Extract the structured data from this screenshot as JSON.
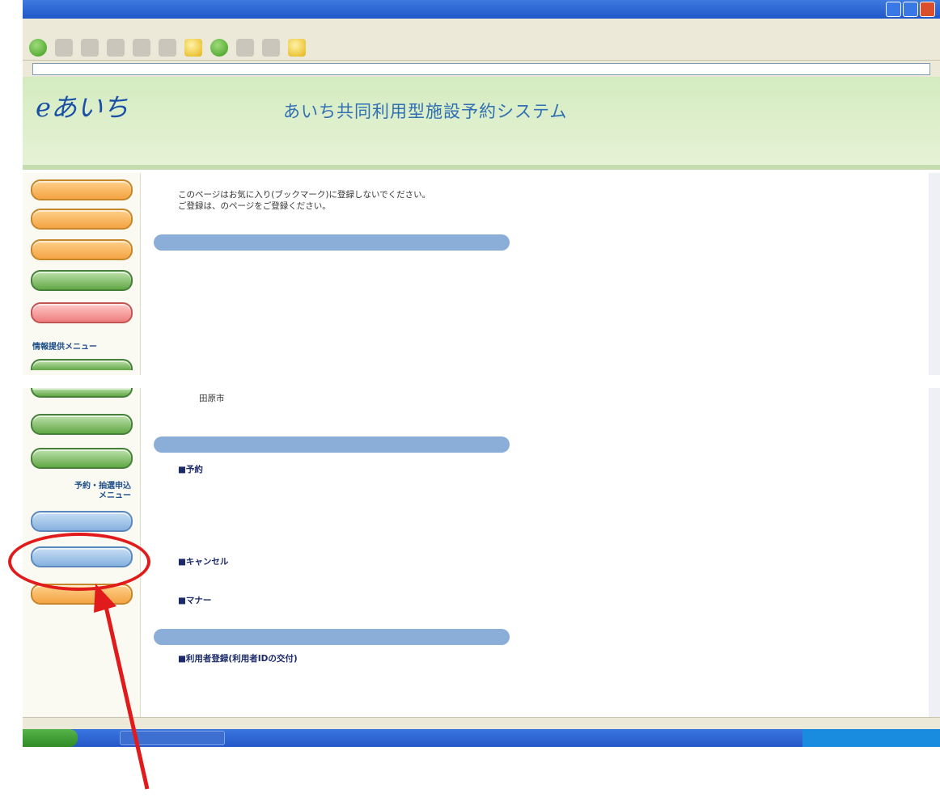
{
  "browser": {
    "title": "",
    "menu_items": [
      "",
      "",
      "",
      "",
      "",
      ""
    ],
    "address": "",
    "go_label": ""
  },
  "banner": {
    "logo_text": "eあいち",
    "title": "あいち共同利用型施設予約システム"
  },
  "sidebar": {
    "info_menu_label": "情報提供メニュー",
    "reserve_menu_label": "予約・抽選申込\nメニュー",
    "buttons_top": [
      "",
      "",
      "",
      "",
      ""
    ],
    "buttons_bottom": [
      "",
      "",
      "",
      "",
      "",
      "",
      ""
    ]
  },
  "content": {
    "notice_1": "このページはお気に入り(ブックマーク)に登録しないでください。",
    "notice_2_prefix": "ご登録は、",
    "notice_link": "",
    "notice_2_suffix": "のページをご登録ください。",
    "section_overview": "",
    "overview_text_1": "",
    "overview_text_2": "",
    "participants_label": "",
    "municipalities_lines": [
      "",
      "",
      ""
    ],
    "portal_label": "",
    "tahara": "田原市",
    "note_1": "",
    "note_2": "",
    "section_usage": "",
    "reserve_title": "■予約",
    "reserve_text": "",
    "limit_title": "",
    "limit_text_1": "",
    "limit_text_2": "",
    "cancel_title": "■キャンセル",
    "cancel_text": "",
    "manner_title": "■マナー",
    "manner_text": "",
    "section_procedure": "",
    "register_title": "■利用者登録(利用者IDの交付)",
    "register_text_1": "",
    "register_text_2": "",
    "register_text_3": ""
  },
  "status": {
    "zone": ""
  },
  "taskbar": {
    "start": "",
    "task": ""
  },
  "annotation": {
    "color": "#e11b1b",
    "target": "sidebar-highlighted-button"
  },
  "colors": {
    "header_blue": "#8aaed8",
    "banner_green": "#d4ebc0",
    "link": "#3a44c8"
  }
}
